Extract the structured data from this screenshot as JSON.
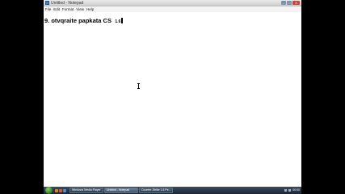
{
  "window": {
    "title": "Untitled - Notepad",
    "buttons": {
      "minimize": "–",
      "maximize": "□",
      "close": "✕"
    }
  },
  "menu": [
    "File",
    "Edit",
    "Format",
    "View",
    "Help"
  ],
  "editor": {
    "text_main": "9. otvqraite papkata CS",
    "text_small": "1.6"
  },
  "taskbar": {
    "tasks": [
      "Windows Media Player",
      "Untitled - Notepad",
      "Counter-Strike 1.6 Pe..."
    ],
    "clock": "00:00"
  },
  "colors": {
    "titlebar": "#dcdcdc",
    "taskbar": "#2a3a4c",
    "close_button": "#c6453a",
    "start_orb": "#4ea02a"
  }
}
